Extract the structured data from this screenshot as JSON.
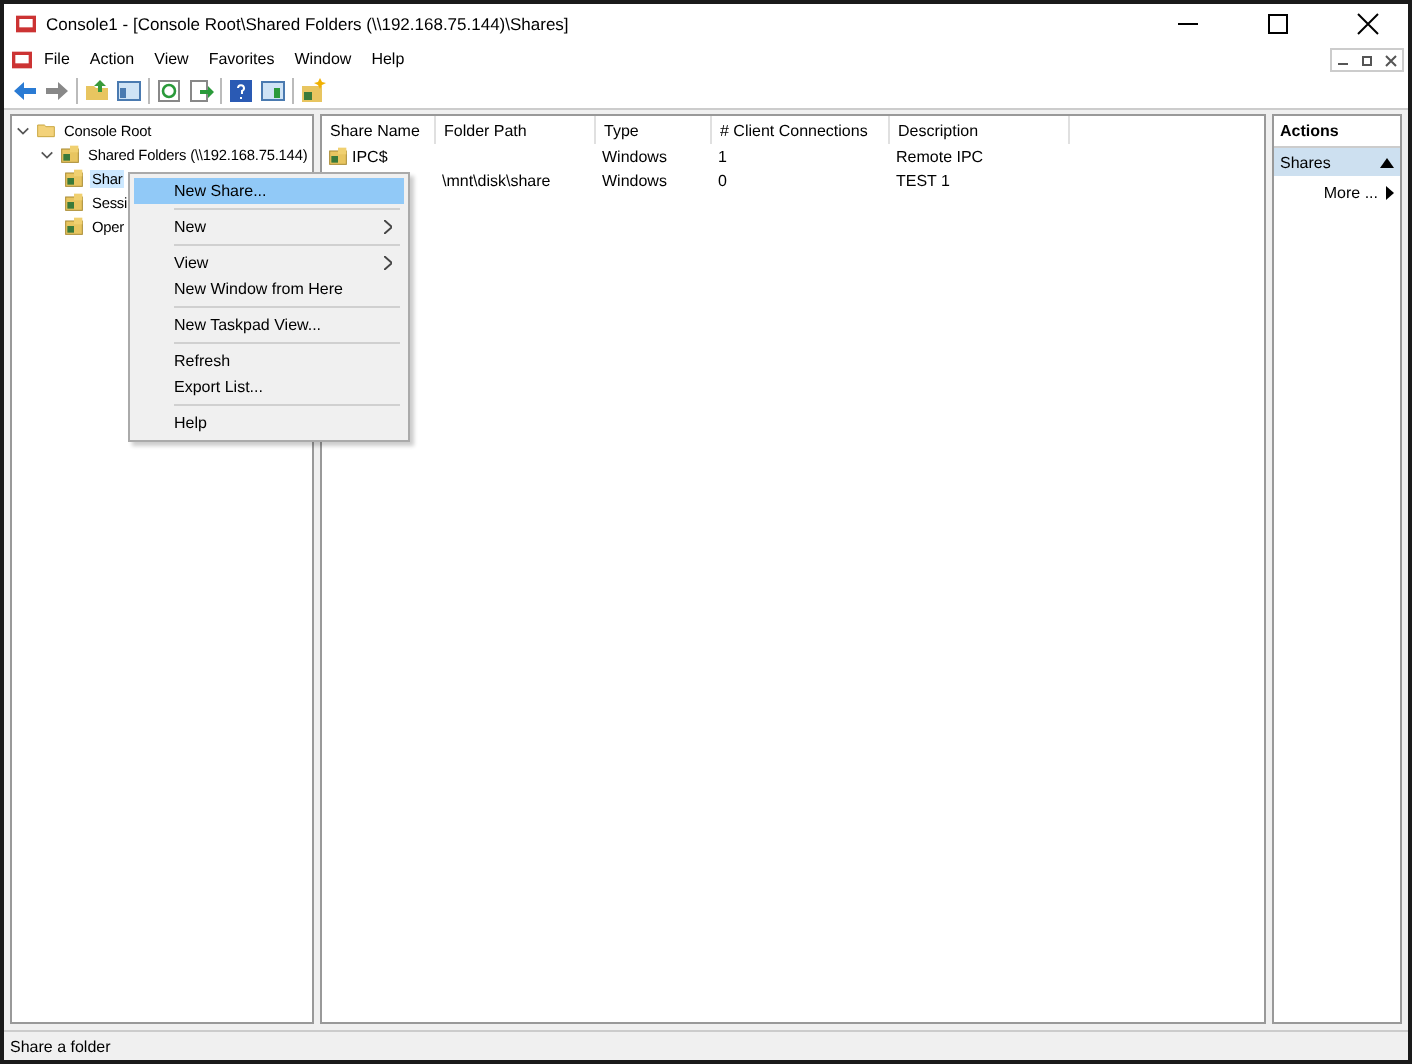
{
  "window": {
    "title": "Console1 - [Console Root\\Shared Folders (\\\\192.168.75.144)\\Shares]"
  },
  "menu_bar": [
    "File",
    "Action",
    "View",
    "Favorites",
    "Window",
    "Help"
  ],
  "tree": [
    {
      "label": "Console Root",
      "expanded": true,
      "selected": false,
      "children": [
        {
          "label": "Shared Folders (\\\\192.168.75.144)",
          "expanded": true,
          "selected": false,
          "children": [
            {
              "label": "Shar",
              "selected": true
            },
            {
              "label": "Sessi",
              "selected": false
            },
            {
              "label": "Oper",
              "selected": false
            }
          ]
        }
      ]
    }
  ],
  "table": {
    "columns": [
      "Share Name",
      "Folder Path",
      "Type",
      "# Client Connections",
      "Description"
    ],
    "rows": [
      [
        "IPC$",
        "",
        "Windows",
        "1",
        "Remote IPC"
      ],
      [
        "",
        "\\mnt\\disk\\share",
        "Windows",
        "0",
        "TEST 1"
      ]
    ]
  },
  "context_menu": [
    {
      "kind": "item",
      "label": "New Share...",
      "selected": true,
      "submenu": false
    },
    {
      "kind": "separator"
    },
    {
      "kind": "item",
      "label": "New",
      "selected": false,
      "submenu": true
    },
    {
      "kind": "separator"
    },
    {
      "kind": "item",
      "label": "View",
      "selected": false,
      "submenu": true
    },
    {
      "kind": "item",
      "label": "New Window from Here",
      "selected": false,
      "submenu": false
    },
    {
      "kind": "separator"
    },
    {
      "kind": "item",
      "label": "New Taskpad View...",
      "selected": false,
      "submenu": false
    },
    {
      "kind": "separator"
    },
    {
      "kind": "item",
      "label": "Refresh",
      "selected": false,
      "submenu": false
    },
    {
      "kind": "item",
      "label": "Export List...",
      "selected": false,
      "submenu": false
    },
    {
      "kind": "separator"
    },
    {
      "kind": "item",
      "label": "Help",
      "selected": false,
      "submenu": false
    }
  ],
  "actions": {
    "title": "Actions",
    "section": "Shares",
    "items": [
      "More ..."
    ]
  },
  "status_bar": "Share a folder"
}
